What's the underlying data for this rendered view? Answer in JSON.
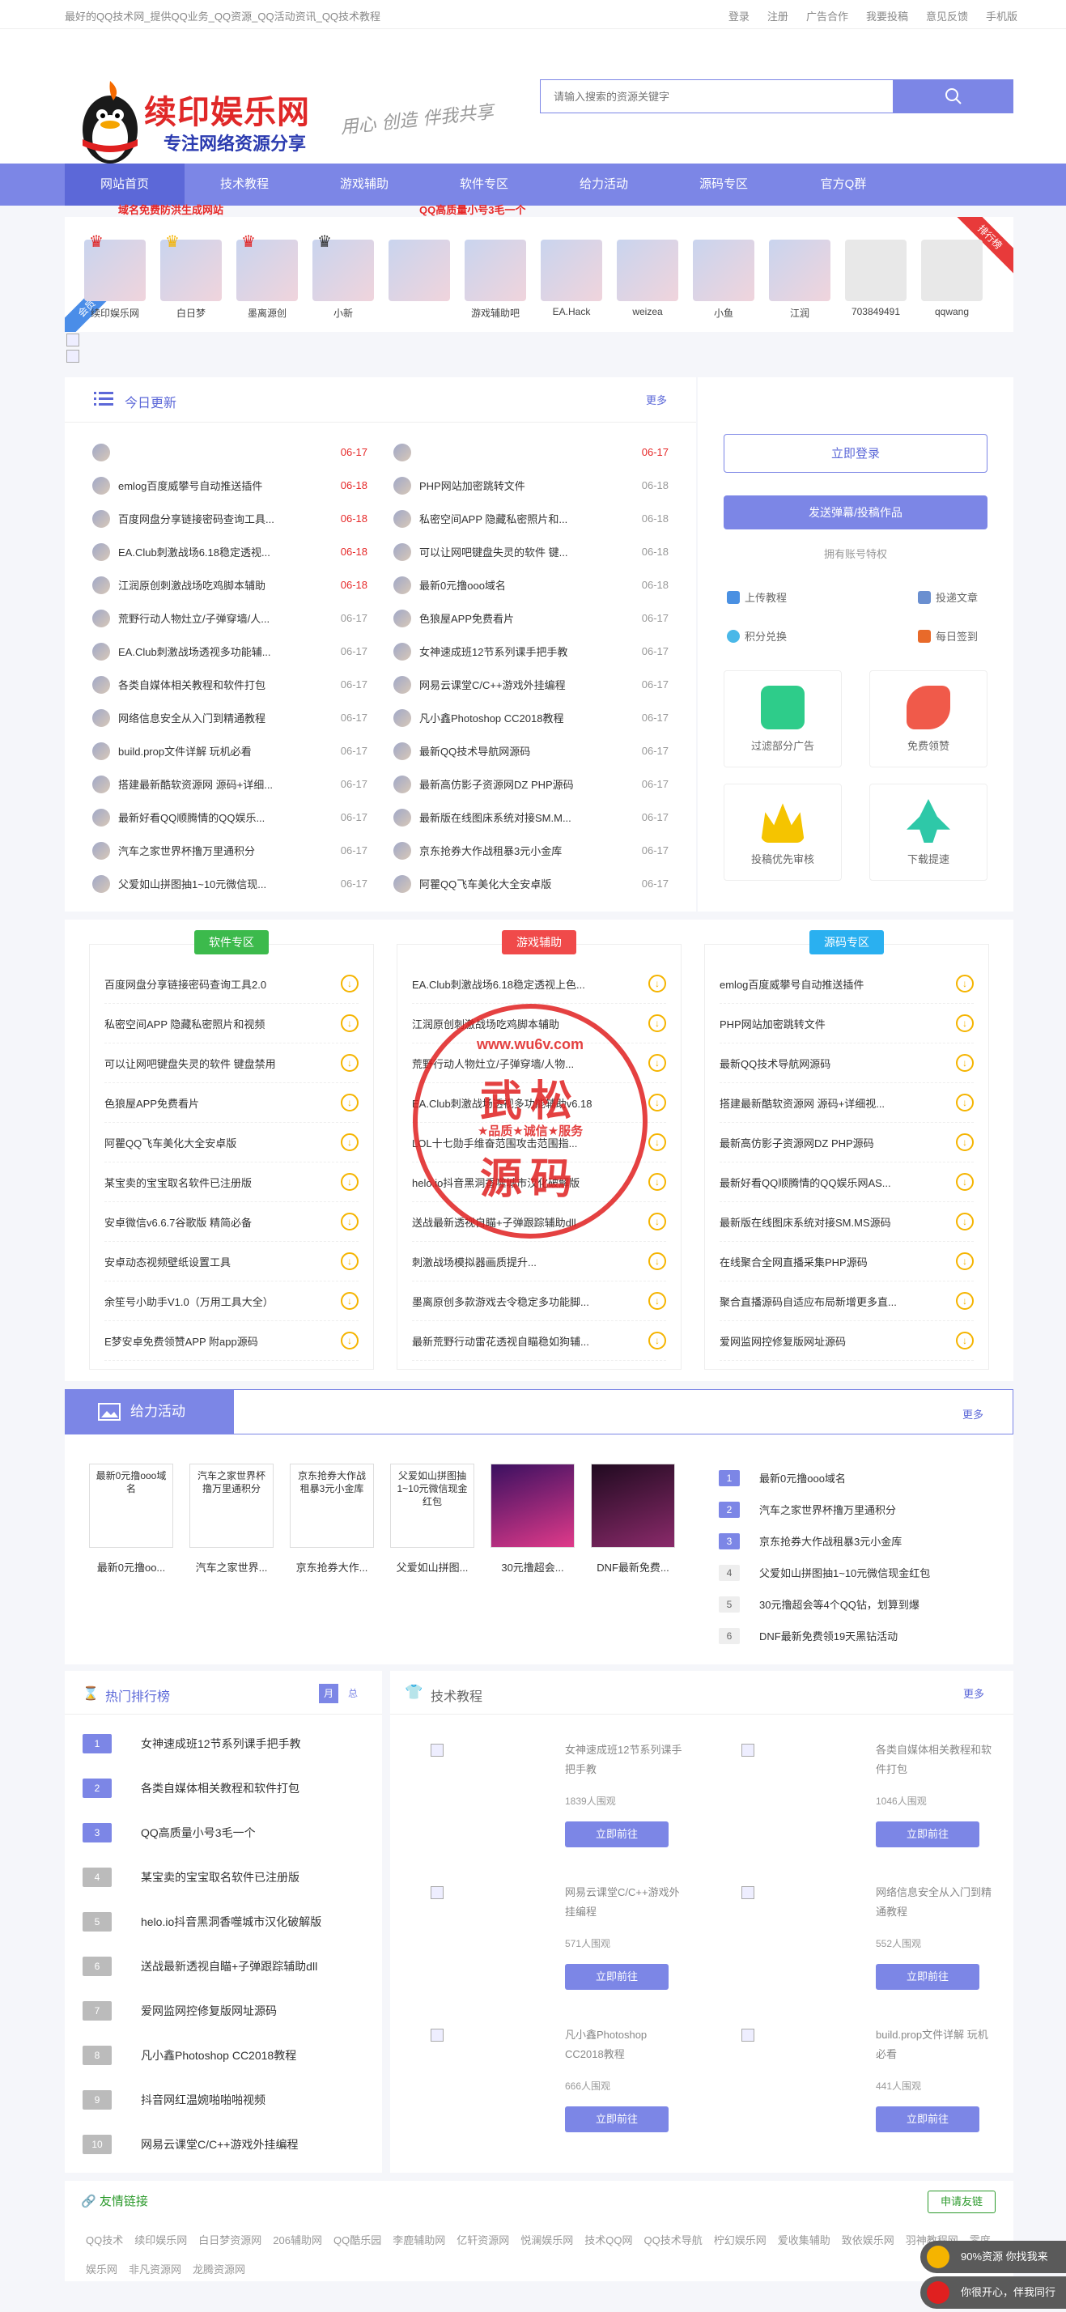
{
  "topbar": {
    "tip": "最好的QQ技术网_提供QQ业务_QQ资源_QQ活动资讯_QQ技术教程",
    "links": [
      "登录",
      "注册",
      "广告合作",
      "我要投稿",
      "意见反馈",
      "手机版"
    ]
  },
  "logo": {
    "title": "续印娱乐网",
    "sub": "专注网络资源分享"
  },
  "slogan": "用心 创造 伴我共享",
  "search": {
    "placeholder": "请输入搜索的资源关键字"
  },
  "nav": [
    "网站首页",
    "技术教程",
    "游戏辅助",
    "软件专区",
    "给力活动",
    "源码专区",
    "官方Q群"
  ],
  "avatars": {
    "ribbon_right": "排行榜",
    "ribbon_left": "会员",
    "users": [
      "续印娱乐网",
      "白日梦",
      "墨离源创",
      "小新",
      "",
      "游戏辅助吧",
      "EA.Hack",
      "weizea",
      "小鱼",
      "江润",
      "703849491",
      "qqwang"
    ]
  },
  "today": {
    "title": "今日更新",
    "more": "更多",
    "left": [
      [
        "域名免费防洪生成网站",
        "06-17"
      ],
      [
        "emlog百度威攀号自动推送插件",
        "06-18"
      ],
      [
        "百度网盘分享链接密码查询工具...",
        "06-18"
      ],
      [
        "EA.Club刺激战场6.18稳定透视...",
        "06-18"
      ],
      [
        "江润原创刺激战场吃鸡脚本辅助",
        "06-18"
      ],
      [
        "荒野行动人物灶立/子弹穿墙/人...",
        "06-17"
      ],
      [
        "EA.Club刺激战场透视多功能辅...",
        "06-17"
      ],
      [
        "各类自媒体相关教程和软件打包",
        "06-17"
      ],
      [
        "网络信息安全从入门到精通教程",
        "06-17"
      ],
      [
        "build.prop文件详解 玩机必看",
        "06-17"
      ],
      [
        "搭建最新酷软资源网 源码+详细...",
        "06-17"
      ],
      [
        "最新好看QQ顺腾情的QQ娱乐...",
        "06-17"
      ],
      [
        "汽车之家世界杯撸万里通积分",
        "06-17"
      ],
      [
        "父爱如山拼图抽1~10元微信现...",
        "06-17"
      ]
    ],
    "right": [
      [
        "QQ高质量小号3毛一个",
        "06-17"
      ],
      [
        "PHP网站加密跳转文件",
        "06-18"
      ],
      [
        "私密空间APP 隐藏私密照片和...",
        "06-18"
      ],
      [
        "可以让网吧键盘失灵的软件 键...",
        "06-18"
      ],
      [
        "最新0元撸ooo域名",
        "06-18"
      ],
      [
        "色狼屋APP免费看片",
        "06-17"
      ],
      [
        "女神速成班12节系列课手把手教",
        "06-17"
      ],
      [
        "网易云课堂C/C++游戏外挂编程",
        "06-17"
      ],
      [
        "凡小鑫Photoshop CC2018教程",
        "06-17"
      ],
      [
        "最新QQ技术导航网源码",
        "06-17"
      ],
      [
        "最新高仿影子资源网DZ PHP源码",
        "06-17"
      ],
      [
        "最新版在线图床系统对接SM.M...",
        "06-17"
      ],
      [
        "京东抢券大作战租暴3元小金库",
        "06-17"
      ],
      [
        "阿瞿QQ飞车美化大全安卓版",
        "06-17"
      ]
    ]
  },
  "side": {
    "login": "立即登录",
    "post": "发送弹幕/投稿作品",
    "priv": "拥有账号特权",
    "p": [
      "上传教程",
      "投递文章",
      "积分兑换",
      "每日签到"
    ],
    "cards": [
      "过滤部分广告",
      "免费领赞",
      "投稿优先审核",
      "下载提速"
    ]
  },
  "zones": [
    {
      "tag": "软件专区",
      "items": [
        "百度网盘分享链接密码查询工具2.0",
        "私密空间APP 隐藏私密照片和视频",
        "可以让网吧键盘失灵的软件 键盘禁用",
        "色狼屋APP免费看片",
        "阿瞿QQ飞车美化大全安卓版",
        "某宝卖的宝宝取名软件已注册版",
        "安卓微信v6.6.7谷歌版 精简必备",
        "安卓动态视频壁纸设置工具",
        "余笙号小助手V1.0（万用工具大全）",
        "E梦安卓免费领赞APP 附app源码"
      ]
    },
    {
      "tag": "游戏辅助",
      "items": [
        "EA.Club刺激战场6.18稳定透视上色...",
        "江润原创刺激战场吃鸡脚本辅助",
        "荒野行动人物灶立/子弹穿墙/人物...",
        "EA.Club刺激战场透视多功能辅助v6.18",
        "LOL十七勋手维奋范围攻击范围指...",
        "helo.io抖音黑洞香噬城市汉化破解版",
        "送战最新透视自瞄+子弹跟踪辅助dll",
        "刺激战场模拟器画质提升...",
        "墨离原创多款游戏去令稳定多功能脚...",
        "最新荒野行动雷花透视自瞄稳如狗辅..."
      ]
    },
    {
      "tag": "源码专区",
      "items": [
        "emlog百度威攀号自动推送插件",
        "PHP网站加密跳转文件",
        "最新QQ技术导航网源码",
        "搭建最新酷软资源网 源码+详细视...",
        "最新高仿影子资源网DZ PHP源码",
        "最新好看QQ顺腾情的QQ娱乐网AS...",
        "最新版在线图床系统对接SM.MS源码",
        "在线聚合全网直播采集PHP源码",
        "聚合直播源码自适应布局新增更多直...",
        "爱网监网控修复版网址源码"
      ]
    }
  ],
  "activity": {
    "title": "给力活动",
    "more": "更多",
    "thumbs": [
      [
        "最新0元撸ooo域名",
        "最新0元撸oo..."
      ],
      [
        "汽车之家世界杯撸万里通积分",
        "汽车之家世界..."
      ],
      [
        "京东抢券大作战租暴3元小金库",
        "京东抢券大作..."
      ],
      [
        "父爱如山拼图抽1~10元微信现金红包",
        "父爱如山拼图..."
      ],
      [
        "",
        "30元撸超会..."
      ],
      [
        "",
        "DNF最新免费..."
      ]
    ],
    "rank": [
      "最新0元撸ooo域名",
      "汽车之家世界杯撸万里通积分",
      "京东抢券大作战租暴3元小金库",
      "父爱如山拼图抽1~10元微信现金红包",
      "30元撸超会等4个QQ钻，划算到爆",
      "DNF最新免费领19天黑钻活动"
    ]
  },
  "hot": {
    "title": "热门排行榜",
    "tabs": [
      "月",
      "总"
    ],
    "items": [
      "女神速成班12节系列课手把手教",
      "各类自媒体相关教程和软件打包",
      "QQ高质量小号3毛一个",
      "某宝卖的宝宝取名软件已注册版",
      "helo.io抖音黑洞香噬城市汉化破解版",
      "送战最新透视自瞄+子弹跟踪辅助dll",
      "爱网监网控修复版网址源码",
      "凡小鑫Photoshop CC2018教程",
      "抖音网红温婉啪啪啪视频",
      "网易云课堂C/C++游戏外挂编程"
    ]
  },
  "tech": {
    "title": "技术教程",
    "more": "更多",
    "go": "立即前往",
    "items": [
      [
        "女神速成班12节系列课手把手教",
        "1839人围观"
      ],
      [
        "各类自媒体相关教程和软件打包",
        "1046人围观"
      ],
      [
        "网易云课堂C/C++游戏外挂编程",
        "571人围观"
      ],
      [
        "网络信息安全从入门到精通教程",
        "552人围观"
      ],
      [
        "凡小鑫Photoshop CC2018教程",
        "666人围观"
      ],
      [
        "build.prop文件详解 玩机必看",
        "441人围观"
      ]
    ]
  },
  "friend": {
    "title": "友情链接",
    "apply": "申请友链",
    "links": [
      "QQ技术",
      "续印娱乐网",
      "白日梦资源网",
      "206辅助网",
      "QQ酷乐园",
      "李鹿辅助网",
      "亿轩资源网",
      "悦澜娱乐网",
      "技术QQ网",
      "QQ技术导航",
      "柠幻娱乐网",
      "爱收集辅助",
      "致依娱乐网",
      "羽神教程网",
      "零度娱乐网",
      "非凡资源网",
      "龙腾资源网"
    ]
  },
  "float": [
    "90%资源 你找我来享！",
    "你很开心，伴我同行"
  ],
  "stamp": {
    "top": "www.wu6v.com",
    "main1": "武松",
    "main2": "源码",
    "mid": "★品质★诚信★服务"
  }
}
